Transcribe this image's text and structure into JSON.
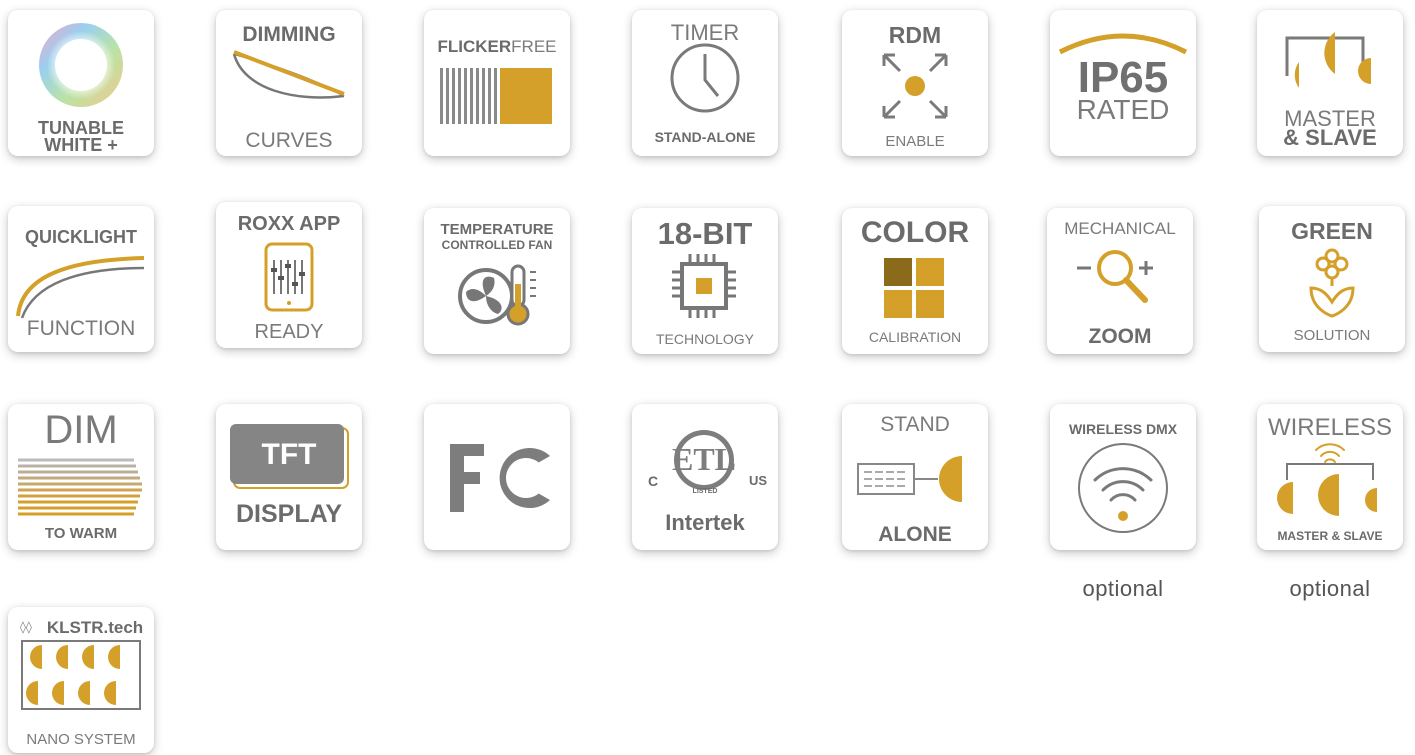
{
  "colors": {
    "gold": "#d4a02a",
    "gray": "#6e6e6e",
    "light_gray": "#a8a8a8",
    "tile_bg": "#ffffff"
  },
  "tiles": [
    {
      "id": "tunable-white",
      "icon": "color-ring-icon",
      "lines": [
        "TUNABLE",
        "WHITE +"
      ]
    },
    {
      "id": "dimming-curves",
      "icon": "dimming-curves-icon",
      "lines": [
        "DIMMING",
        "CURVES"
      ]
    },
    {
      "id": "flicker-free",
      "icon": "flicker-bars-icon",
      "lines": [
        "FLICKER",
        "FREE"
      ]
    },
    {
      "id": "timer",
      "icon": "clock-icon",
      "lines": [
        "TIMER",
        "STAND-ALONE"
      ]
    },
    {
      "id": "rdm",
      "icon": "rdm-arrows-icon",
      "lines": [
        "RDM",
        "ENABLE"
      ]
    },
    {
      "id": "ip65",
      "icon": "arc-icon",
      "lines": [
        "IP65",
        "RATED"
      ]
    },
    {
      "id": "master-slave",
      "icon": "master-slave-icon",
      "lines": [
        "MASTER",
        "& SLAVE"
      ]
    },
    {
      "id": "quicklight",
      "icon": "quicklight-curve-icon",
      "lines": [
        "QUICKLIGHT",
        "FUNCTION"
      ]
    },
    {
      "id": "roxx-app",
      "icon": "phone-mixer-icon",
      "lines": [
        "ROXX APP",
        "READY"
      ]
    },
    {
      "id": "temperature-fan",
      "icon": "fan-thermometer-icon",
      "lines": [
        "TEMPERATURE",
        "CONTROLLED FAN"
      ]
    },
    {
      "id": "18-bit",
      "icon": "chip-icon",
      "lines": [
        "18-BIT",
        "TECHNOLOGY"
      ]
    },
    {
      "id": "color-calibration",
      "icon": "color-squares-icon",
      "lines": [
        "COLOR",
        "CALIBRATION"
      ]
    },
    {
      "id": "mechanical-zoom",
      "icon": "magnifier-icon",
      "lines": [
        "MECHANICAL",
        "ZOOM"
      ]
    },
    {
      "id": "green-solution",
      "icon": "flower-icon",
      "lines": [
        "GREEN",
        "SOLUTION"
      ]
    },
    {
      "id": "dim-to-warm",
      "icon": "warm-lines-icon",
      "lines": [
        "DIM",
        "TO WARM"
      ]
    },
    {
      "id": "tft-display",
      "icon": "tft-screen-icon",
      "lines": [
        "TFT",
        "DISPLAY"
      ]
    },
    {
      "id": "fcc",
      "icon": "fcc-logo-icon",
      "lines": []
    },
    {
      "id": "etl",
      "icon": "etl-logo-icon",
      "lines": [
        "C",
        "US",
        "LISTED",
        "Intertek"
      ]
    },
    {
      "id": "stand-alone",
      "icon": "keypad-lamp-icon",
      "lines": [
        "STAND",
        "ALONE"
      ]
    },
    {
      "id": "wireless-dmx",
      "icon": "wifi-icon",
      "lines": [
        "WIRELESS DMX"
      ]
    },
    {
      "id": "wireless-master-slave",
      "icon": "wireless-master-slave-icon",
      "lines": [
        "WIRELESS",
        "MASTER & SLAVE"
      ]
    },
    {
      "id": "klstr-nano",
      "icon": "klstr-grid-icon",
      "lines": [
        "KLSTR.tech",
        "NANO SYSTEM"
      ]
    }
  ],
  "notes": [
    "optional",
    "optional"
  ]
}
